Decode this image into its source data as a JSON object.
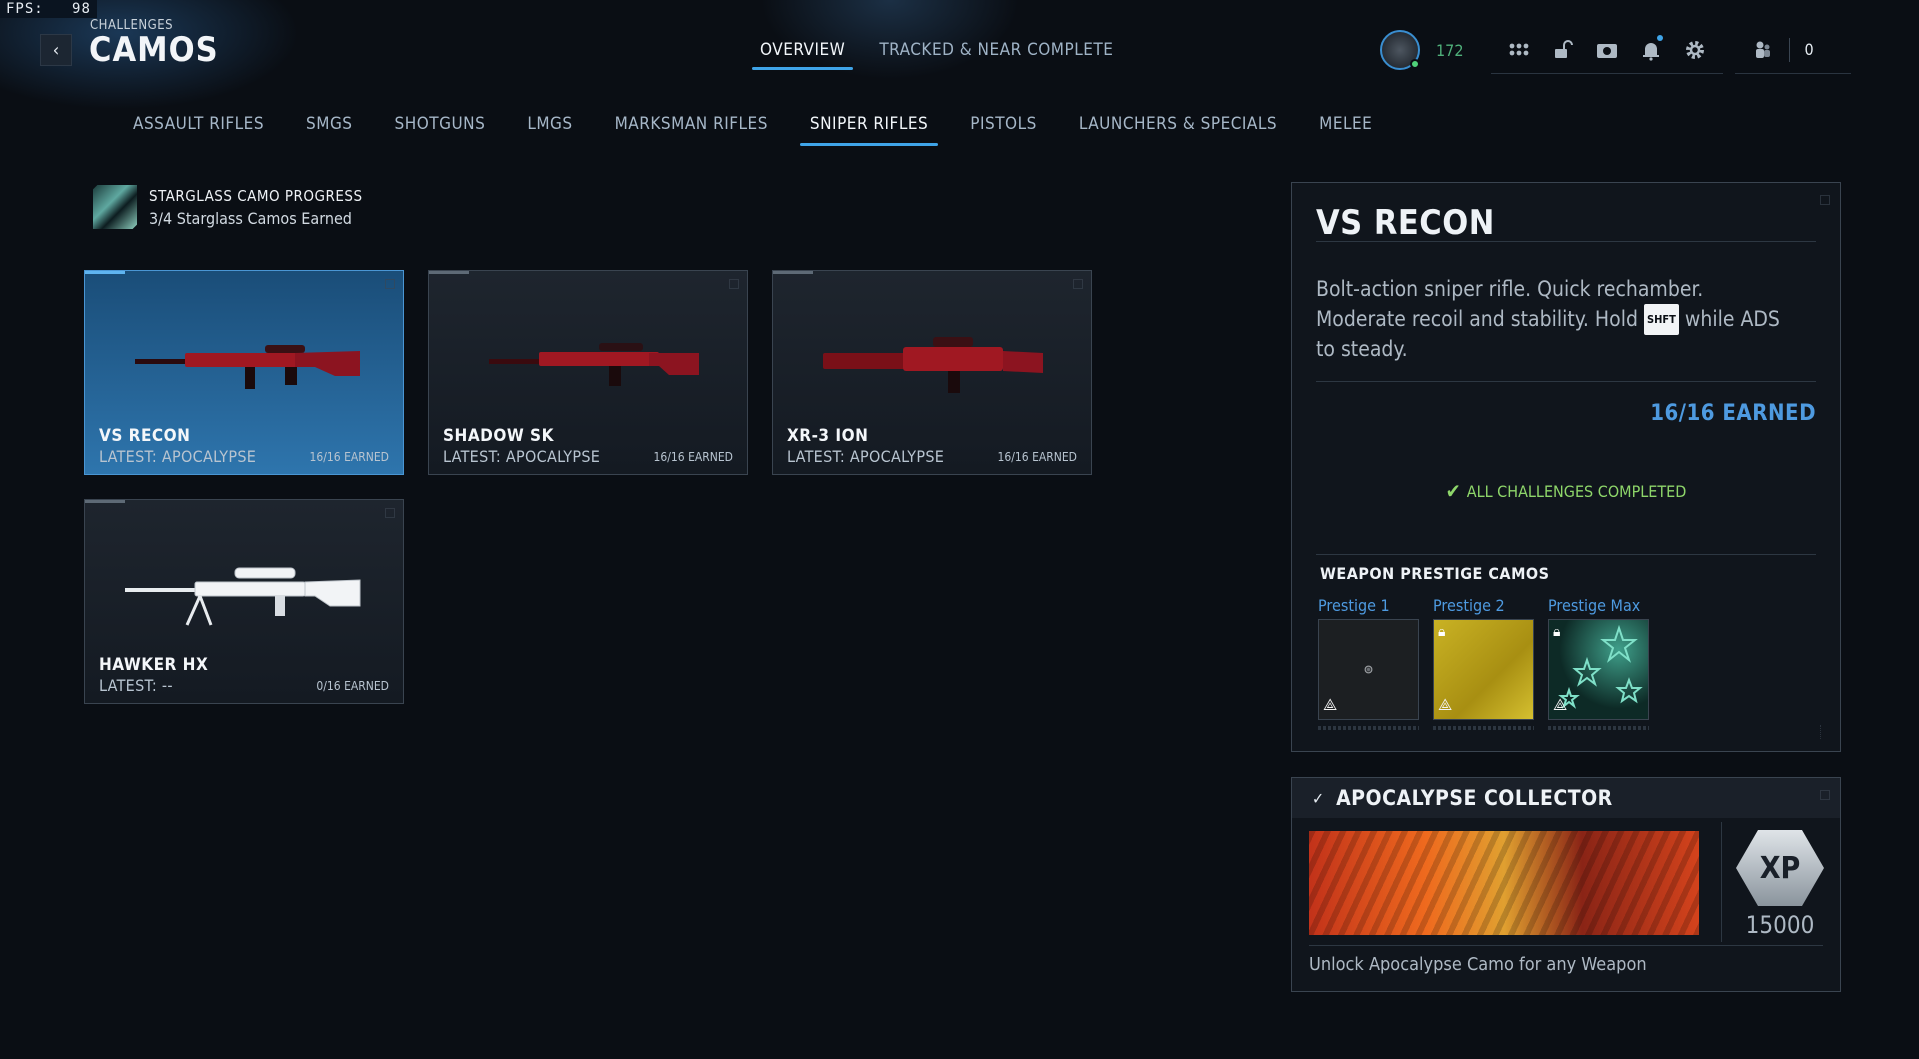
{
  "fps": {
    "label": "FPS:",
    "value": "98"
  },
  "header": {
    "breadcrumb": "CHALLENGES",
    "title": "CAMOS",
    "back_icon": "chevron-left-icon"
  },
  "top_tabs": [
    {
      "label": "OVERVIEW",
      "active": true
    },
    {
      "label": "TRACKED & NEAR COMPLETE",
      "active": false
    }
  ],
  "top_right": {
    "level": "172",
    "icons": [
      "apps-grid-icon",
      "unlock-icon",
      "store-icon",
      "bell-icon",
      "gear-icon"
    ],
    "friends_count": "0"
  },
  "categories": [
    {
      "label": "ASSAULT RIFLES"
    },
    {
      "label": "SMGS"
    },
    {
      "label": "SHOTGUNS"
    },
    {
      "label": "LMGS"
    },
    {
      "label": "MARKSMAN RIFLES"
    },
    {
      "label": "SNIPER RIFLES",
      "active": true
    },
    {
      "label": "PISTOLS"
    },
    {
      "label": "LAUNCHERS & SPECIALS"
    },
    {
      "label": "MELEE"
    }
  ],
  "starglass": {
    "title": "STARGLASS CAMO PROGRESS",
    "subtitle": "3/4 Starglass Camos Earned"
  },
  "weapons": [
    {
      "name": "VS RECON",
      "latest": "LATEST: APOCALYPSE",
      "earned": "16/16 EARNED"
    },
    {
      "name": "SHADOW SK",
      "latest": "LATEST: APOCALYPSE",
      "earned": "16/16 EARNED"
    },
    {
      "name": "XR-3 ION",
      "latest": "LATEST: APOCALYPSE",
      "earned": "16/16 EARNED"
    },
    {
      "name": "HAWKER HX",
      "latest": "LATEST: --",
      "earned": "0/16 EARNED"
    }
  ],
  "detail": {
    "title": "VS RECON",
    "desc_1": "Bolt-action sniper rifle.  Quick rechamber.",
    "desc_2a": "Moderate recoil and stability.  Hold ",
    "desc_key": "SHFT",
    "desc_2b": " while ADS",
    "desc_3": "to steady.",
    "earned": "16/16 EARNED",
    "status": "ALL CHALLENGES COMPLETED",
    "prestige_title": "WEAPON PRESTIGE CAMOS",
    "prestige": [
      {
        "label": "Prestige 1",
        "locked": false
      },
      {
        "label": "Prestige 2",
        "locked": true
      },
      {
        "label": "Prestige Max",
        "locked": true
      }
    ]
  },
  "achievement": {
    "title": "APOCALYPSE COLLECTOR",
    "xp_label": "XP",
    "xp_value": "15000",
    "description": "Unlock Apocalypse Camo for any Weapon"
  },
  "colors": {
    "accent_blue": "#3fa4e8",
    "earned_blue": "#4e9ae0",
    "complete_green": "#8ed66a",
    "level_green": "#4fb07a"
  }
}
